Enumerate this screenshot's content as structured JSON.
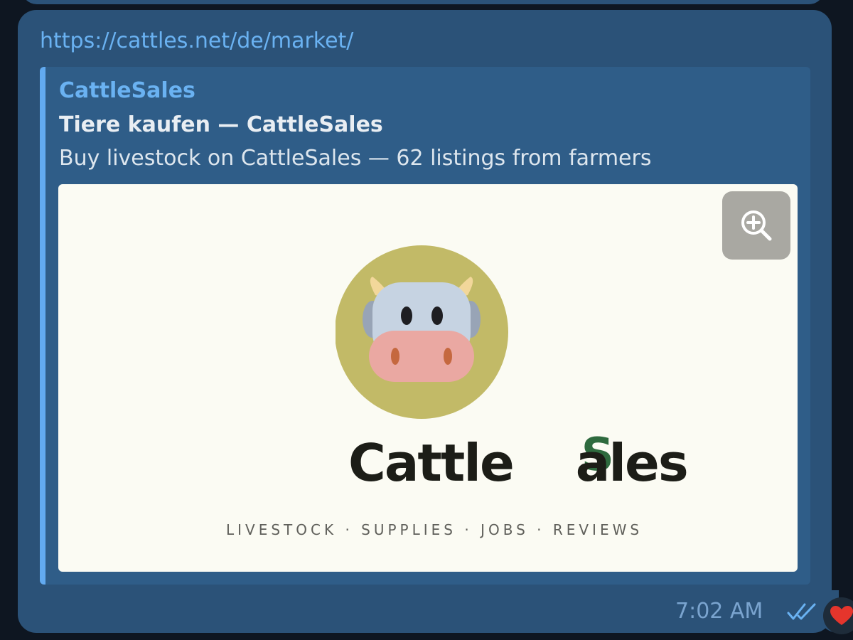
{
  "message": {
    "url": "https://cattles.net/de/market/",
    "time": "7:02 AM",
    "status_icon": "double-check-icon",
    "reaction_icon": "heart-icon"
  },
  "link_preview": {
    "site_name": "CattleSales",
    "title": "Tiere kaufen — CattleSales",
    "description": "Buy livestock on CattleSales — 62 listings from farmers",
    "image": {
      "wordmark_left": "Cattle",
      "wordmark_overlap_back": "S",
      "wordmark_overlap_front": "a",
      "wordmark_right": "les",
      "tagline": "LIVESTOCK · SUPPLIES · JOBS · REVIEWS",
      "zoom_icon": "zoom-in-icon"
    }
  },
  "colors": {
    "chat_background": "#0e1621",
    "bubble": "#2b5278",
    "link": "#6ab2f2",
    "preview_accent": "#62aaf0",
    "logo_circle": "#c2ba67",
    "cow_snout": "#eaa8a2",
    "wordmark_green": "#2e6a3e"
  }
}
